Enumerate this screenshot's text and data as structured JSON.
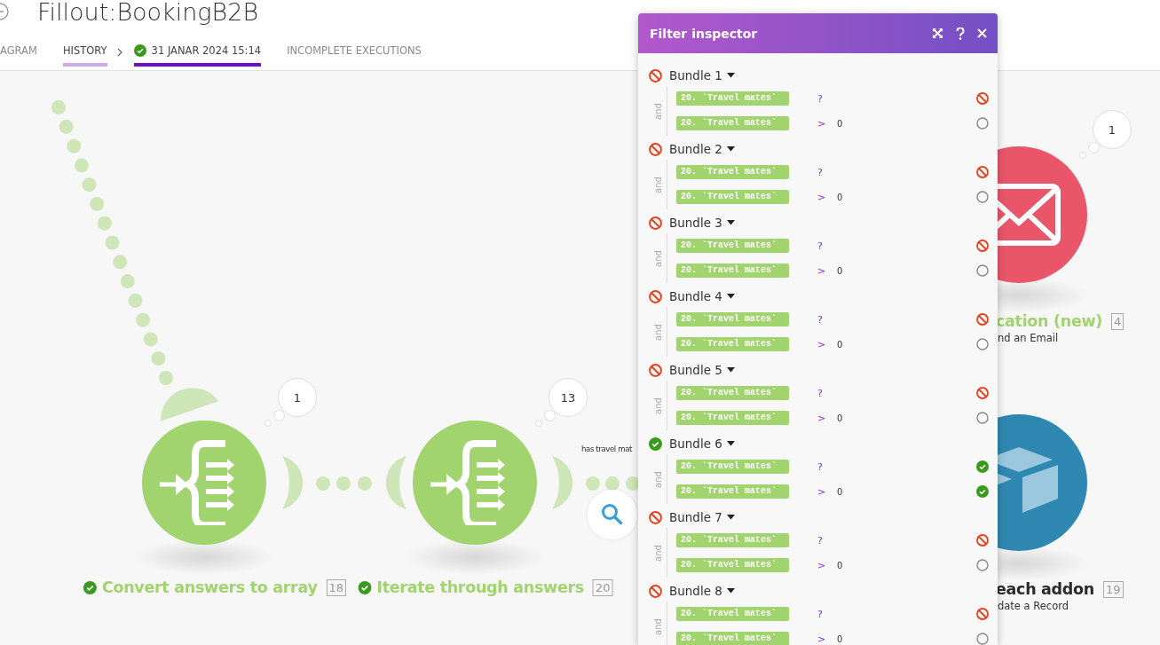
{
  "header": {
    "title": "Fillout:BookingB2B"
  },
  "tabs": [
    {
      "label": "AGRAM",
      "kind": "tab",
      "selected": false
    },
    {
      "label": "HISTORY",
      "kind": "crumb",
      "selected": false
    },
    {
      "label": "31 JANAR 2024 15:14",
      "kind": "run",
      "selected": true
    },
    {
      "label": "INCOMPLETE EXECUTIONS",
      "kind": "tab",
      "selected": false
    }
  ],
  "modules": [
    {
      "label": "Convert answers to array",
      "number": "18",
      "operations": "1",
      "kind": "iterator",
      "succeeded": true
    },
    {
      "label": "Iterate through answers",
      "number": "20",
      "operations": "13",
      "kind": "iterator",
      "succeeded": true
    },
    {
      "label": "cation (new)",
      "subtitle": "nd an Email",
      "number": "4",
      "operations": "1",
      "kind": "email",
      "succeeded": true
    },
    {
      "label": "each addon",
      "subtitle": "date a Record",
      "number": "19",
      "kind": "database",
      "succeeded": false
    }
  ],
  "filter": {
    "label": "has travel mat"
  },
  "inspector": {
    "title": "Filter inspector",
    "bundles": [
      {
        "label": "Bundle 1",
        "passed": false,
        "joiner": "and",
        "conditions": [
          {
            "field": "20. `Travel mates`",
            "operator": "?",
            "evaluated": true,
            "passed": false
          },
          {
            "field": "20. `Travel mates`",
            "operator": ">",
            "value": "0",
            "evaluated": false
          }
        ]
      },
      {
        "label": "Bundle 2",
        "passed": false,
        "joiner": "and",
        "conditions": [
          {
            "field": "20. `Travel mates`",
            "operator": "?",
            "evaluated": true,
            "passed": false
          },
          {
            "field": "20. `Travel mates`",
            "operator": ">",
            "value": "0",
            "evaluated": false
          }
        ]
      },
      {
        "label": "Bundle 3",
        "passed": false,
        "joiner": "and",
        "conditions": [
          {
            "field": "20. `Travel mates`",
            "operator": "?",
            "evaluated": true,
            "passed": false
          },
          {
            "field": "20. `Travel mates`",
            "operator": ">",
            "value": "0",
            "evaluated": false
          }
        ]
      },
      {
        "label": "Bundle 4",
        "passed": false,
        "joiner": "and",
        "conditions": [
          {
            "field": "20. `Travel mates`",
            "operator": "?",
            "evaluated": true,
            "passed": false
          },
          {
            "field": "20. `Travel mates`",
            "operator": ">",
            "value": "0",
            "evaluated": false
          }
        ]
      },
      {
        "label": "Bundle 5",
        "passed": false,
        "joiner": "and",
        "conditions": [
          {
            "field": "20. `Travel mates`",
            "operator": "?",
            "evaluated": true,
            "passed": false
          },
          {
            "field": "20. `Travel mates`",
            "operator": ">",
            "value": "0",
            "evaluated": false
          }
        ]
      },
      {
        "label": "Bundle 6",
        "passed": true,
        "joiner": "and",
        "conditions": [
          {
            "field": "20. `Travel mates`",
            "operator": "?",
            "evaluated": true,
            "passed": true
          },
          {
            "field": "20. `Travel mates`",
            "operator": ">",
            "value": "0",
            "evaluated": true,
            "passed": true
          }
        ]
      },
      {
        "label": "Bundle 7",
        "passed": false,
        "joiner": "and",
        "conditions": [
          {
            "field": "20. `Travel mates`",
            "operator": "?",
            "evaluated": true,
            "passed": false
          },
          {
            "field": "20. `Travel mates`",
            "operator": ">",
            "value": "0",
            "evaluated": false
          }
        ]
      },
      {
        "label": "Bundle 8",
        "passed": false,
        "joiner": "and",
        "conditions": [
          {
            "field": "20. `Travel mates`",
            "operator": "?",
            "evaluated": true,
            "passed": false
          },
          {
            "field": "20. `Travel mates`",
            "operator": ">",
            "value": "0",
            "evaluated": false
          }
        ]
      }
    ]
  }
}
